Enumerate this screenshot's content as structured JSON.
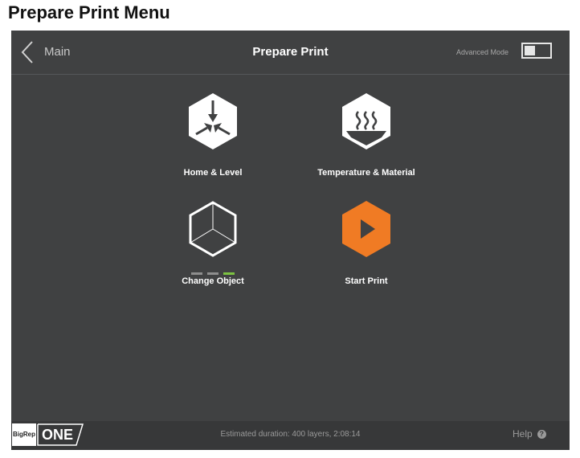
{
  "document": {
    "heading": "Prepare Print Menu"
  },
  "header": {
    "back_label": "Main",
    "title": "Prepare Print",
    "advanced_mode_label": "Advanced Mode",
    "advanced_mode_on": false
  },
  "tiles": [
    {
      "label": "Home & Level",
      "icon": "home-level-icon"
    },
    {
      "label": "Temperature & Material",
      "icon": "temperature-material-icon"
    },
    {
      "label": "Change Object",
      "icon": "cube-icon",
      "progress": [
        "inactive",
        "inactive",
        "active"
      ]
    },
    {
      "label": "Start Print",
      "icon": "play-icon"
    }
  ],
  "footer": {
    "logo_left": "BigRep",
    "logo_right": "ONE",
    "status": "Estimated duration: 400 layers, 2:08:14",
    "help_label": "Help"
  },
  "colors": {
    "background": "#404142",
    "footer_background": "#373839",
    "accent_orange": "#f07b24",
    "active_green": "#7cc242",
    "inactive_gray": "#8e8e8e",
    "icon_white": "#ffffff"
  }
}
